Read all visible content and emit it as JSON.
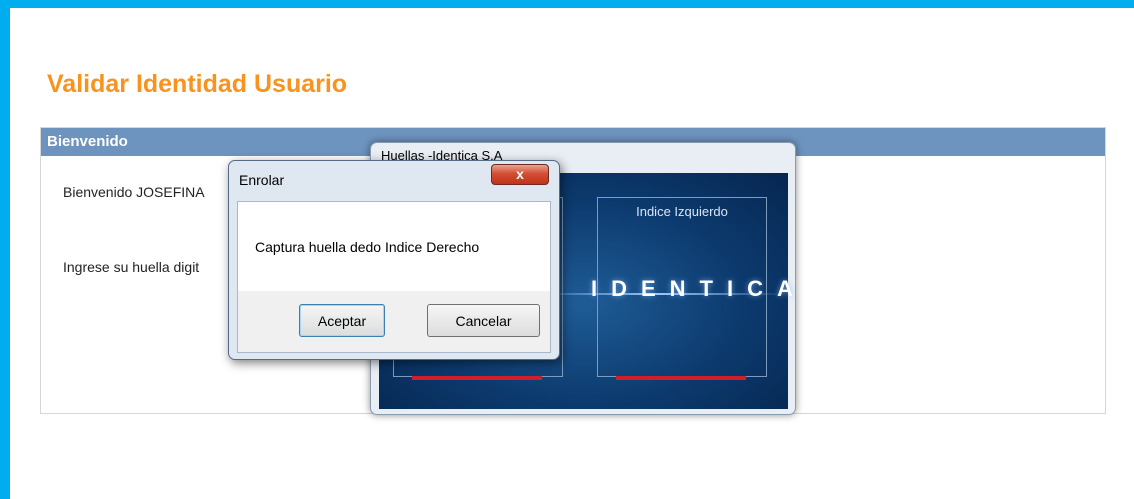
{
  "page": {
    "title": "Validar Identidad Usuario"
  },
  "panel": {
    "header": "Bienvenido",
    "welcome": "Bienvenido JOSEFINA",
    "prompt": "Ingrese su huella digit"
  },
  "huellas_window": {
    "title": "Huellas -Identica S.A",
    "right_label": "Indice Izquierdo",
    "brand": "IDENTICA"
  },
  "dialog": {
    "title": "Enrolar",
    "close_label": "x",
    "message": "Captura huella dedo Indice Derecho",
    "accept_label": "Aceptar",
    "cancel_label": "Cancelar"
  },
  "colors": {
    "frame": "#00aeef",
    "title": "#f7931e",
    "panel_header": "#6d93bf",
    "close_button": "#c2321c",
    "capture_bar": "#d11f2a"
  }
}
